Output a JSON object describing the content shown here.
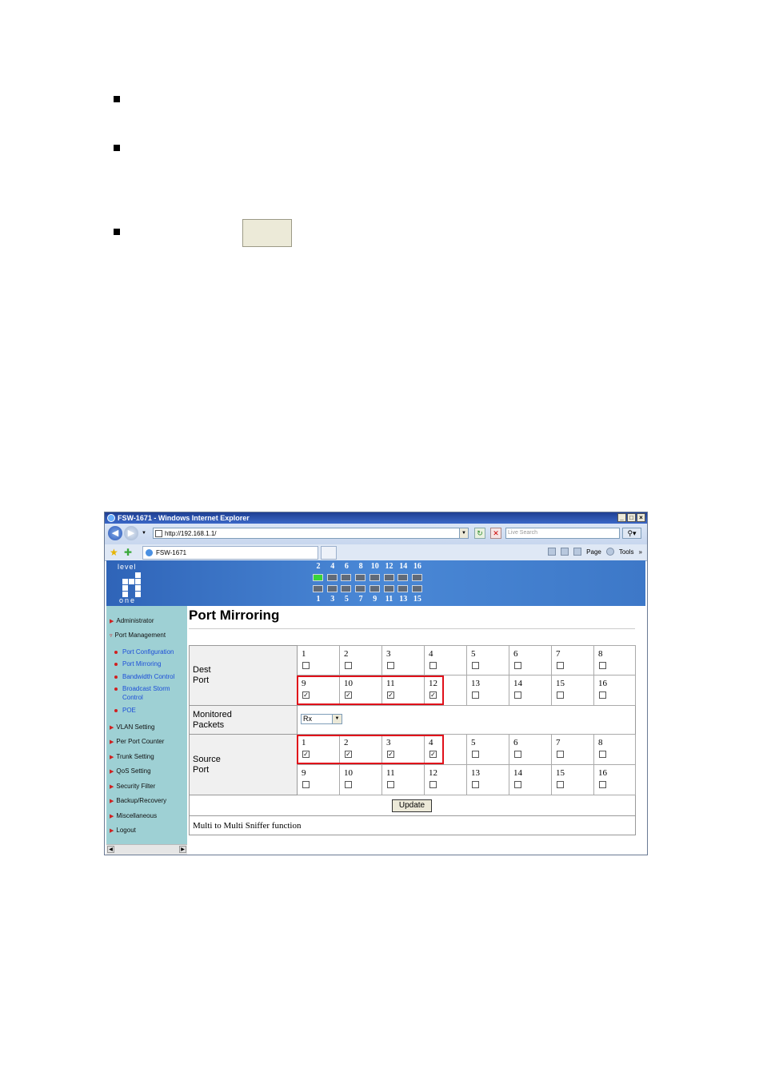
{
  "window": {
    "title": "FSW-1671 - Windows Internet Explorer",
    "min": "_",
    "max": "□",
    "close": "×"
  },
  "address": {
    "url": "http://192.168.1.1/",
    "search_placeholder": "Live Search"
  },
  "tab": {
    "title": "FSW-1671"
  },
  "commands": {
    "page": "Page",
    "tools": "Tools",
    "more": "»"
  },
  "logo": {
    "top": "level",
    "bottom": "one"
  },
  "ports": {
    "top_numbers": [
      "2",
      "4",
      "6",
      "8",
      "10",
      "12",
      "14",
      "16"
    ],
    "bottom_numbers": [
      "1",
      "3",
      "5",
      "7",
      "9",
      "11",
      "13",
      "15"
    ],
    "active_top_index": 0
  },
  "sidebar": {
    "items": [
      {
        "label": "Administrator"
      },
      {
        "label": "Port Management"
      }
    ],
    "sub_items": [
      {
        "label": "Port Configuration"
      },
      {
        "label": "Port Mirroring"
      },
      {
        "label": "Bandwidth Control"
      },
      {
        "label": "Broadcast Storm"
      },
      {
        "label": "Control"
      },
      {
        "label": "POE"
      }
    ],
    "more_items": [
      {
        "label": "VLAN Setting"
      },
      {
        "label": "Per Port Counter"
      },
      {
        "label": "Trunk Setting"
      },
      {
        "label": "QoS Setting"
      },
      {
        "label": "Security Filter"
      },
      {
        "label": "Backup/Recovery"
      },
      {
        "label": "Miscellaneous"
      },
      {
        "label": "Logout"
      }
    ]
  },
  "main": {
    "title": "Port Mirroring",
    "dest_label_1": "Dest",
    "dest_label_2": "Port",
    "monitored_label_1": "Monitored",
    "monitored_label_2": "Packets",
    "monitored_value": "Rx",
    "source_label_1": "Source",
    "source_label_2": "Port",
    "dest_ports": [
      {
        "n": "1",
        "c": false
      },
      {
        "n": "2",
        "c": false
      },
      {
        "n": "3",
        "c": false
      },
      {
        "n": "4",
        "c": false
      },
      {
        "n": "5",
        "c": false
      },
      {
        "n": "6",
        "c": false
      },
      {
        "n": "7",
        "c": false
      },
      {
        "n": "8",
        "c": false
      },
      {
        "n": "9",
        "c": true
      },
      {
        "n": "10",
        "c": true
      },
      {
        "n": "11",
        "c": true
      },
      {
        "n": "12",
        "c": true
      },
      {
        "n": "13",
        "c": false
      },
      {
        "n": "14",
        "c": false
      },
      {
        "n": "15",
        "c": false
      },
      {
        "n": "16",
        "c": false
      }
    ],
    "source_ports": [
      {
        "n": "1",
        "c": true
      },
      {
        "n": "2",
        "c": true
      },
      {
        "n": "3",
        "c": true
      },
      {
        "n": "4",
        "c": true
      },
      {
        "n": "5",
        "c": false
      },
      {
        "n": "6",
        "c": false
      },
      {
        "n": "7",
        "c": false
      },
      {
        "n": "8",
        "c": false
      },
      {
        "n": "9",
        "c": false
      },
      {
        "n": "10",
        "c": false
      },
      {
        "n": "11",
        "c": false
      },
      {
        "n": "12",
        "c": false
      },
      {
        "n": "13",
        "c": false
      },
      {
        "n": "14",
        "c": false
      },
      {
        "n": "15",
        "c": false
      },
      {
        "n": "16",
        "c": false
      }
    ],
    "update_label": "Update",
    "footer_note": "Multi to Multi Sniffer function"
  },
  "icons": {
    "check": "✓"
  }
}
